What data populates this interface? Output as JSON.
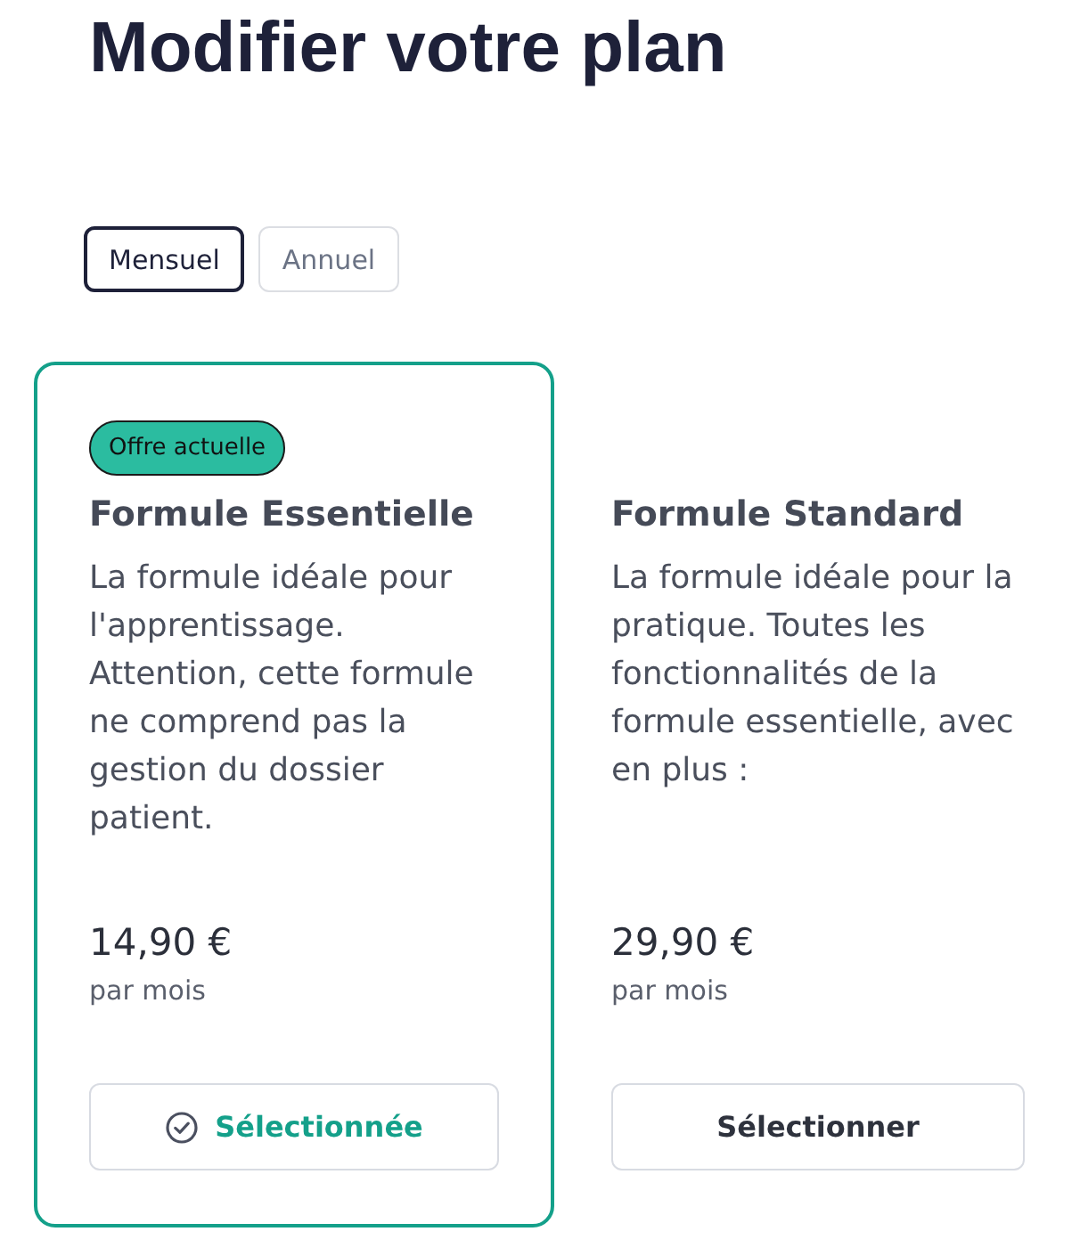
{
  "page": {
    "title": "Modifier votre plan"
  },
  "billing_tabs": [
    {
      "label": "Mensuel",
      "selected": true
    },
    {
      "label": "Annuel",
      "selected": false
    }
  ],
  "plans": [
    {
      "badge": "Offre actuelle",
      "name": "Formule Essentielle",
      "description": "La formule idéale pour l'apprentissage. Attention, cette formule ne comprend pas la gestion du dossier patient.",
      "price": "14,90 €",
      "period": "par mois",
      "button": "Sélectionnée",
      "selected": true
    },
    {
      "name": "Formule Standard",
      "description": "La formule idéale pour la pratique. Toutes les fonctionnalités de la formule essentielle, avec en plus :",
      "price": "29,90 €",
      "period": "par mois",
      "button": "Sélectionner",
      "selected": false
    }
  ]
}
